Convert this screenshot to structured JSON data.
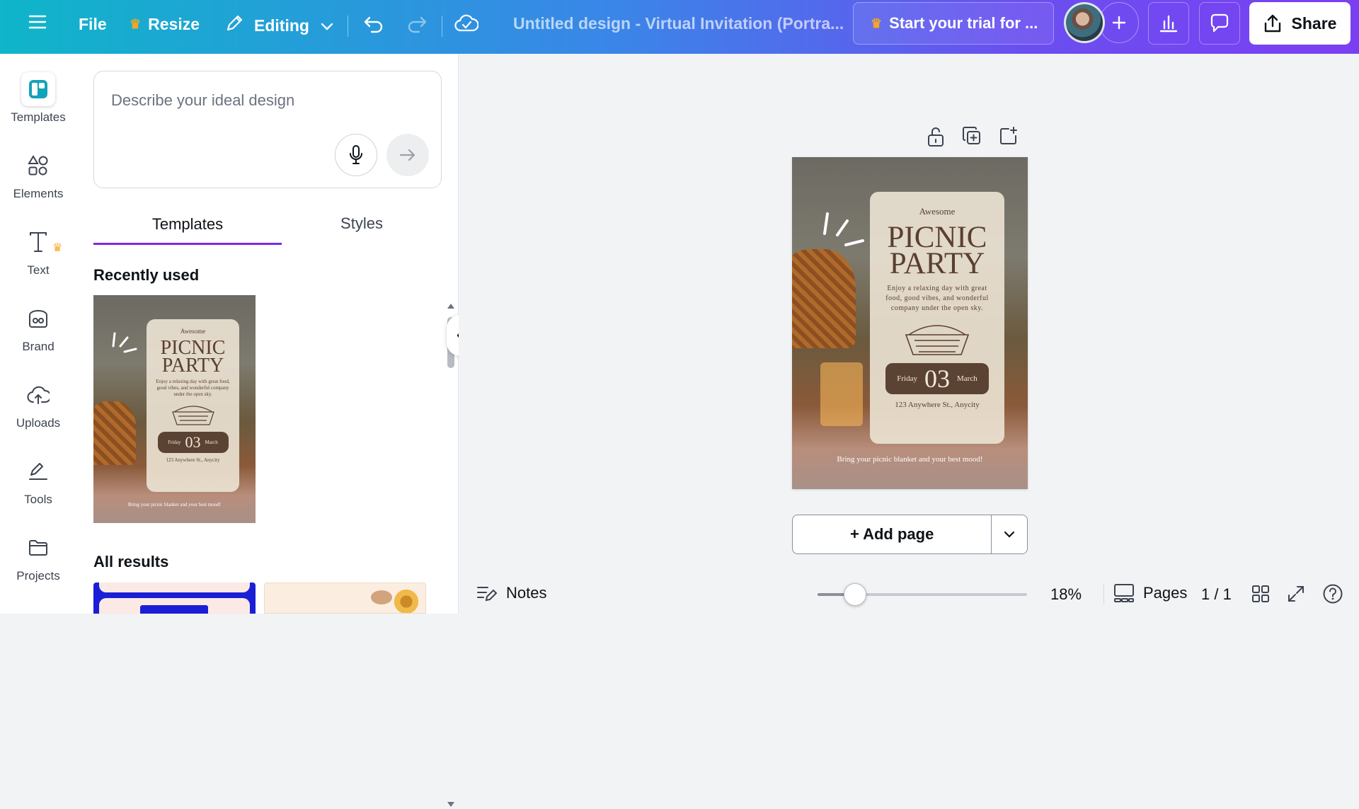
{
  "topbar": {
    "file_label": "File",
    "resize_label": "Resize",
    "editing_label": "Editing",
    "doc_title": "Untitled design - Virtual Invitation (Portra...",
    "trial_label": "Start your trial for ...",
    "share_label": "Share"
  },
  "rail": {
    "items": [
      {
        "label": "Templates"
      },
      {
        "label": "Elements"
      },
      {
        "label": "Text"
      },
      {
        "label": "Brand"
      },
      {
        "label": "Uploads"
      },
      {
        "label": "Tools"
      },
      {
        "label": "Projects"
      }
    ]
  },
  "panel": {
    "prompt_placeholder": "Describe your ideal design",
    "tabs": [
      "Templates",
      "Styles"
    ],
    "recently_used": "Recently used",
    "all_results": "All results"
  },
  "poster": {
    "kicker": "Awesome",
    "title_line1": "PICNIC",
    "title_line2": "PARTY",
    "body": "Enjoy a relaxing day with great food, good vibes, and wonderful company under the open sky.",
    "day": "Friday",
    "date": "03",
    "month": "March",
    "address": "123 Anywhere St., Anycity",
    "footer": "Bring your picnic blanket and your best mood!"
  },
  "canvas": {
    "add_page_label": "+ Add page"
  },
  "bottom": {
    "notes_label": "Notes",
    "zoom_value": "18%",
    "zoom_level": 0.18,
    "pages_label": "Pages",
    "page_count": "1 / 1"
  },
  "colors": {
    "accent": "#7d2ae8",
    "topbar_start": "#0fb5c9",
    "topbar_end": "#7b3ff2",
    "crown": "#f5a623"
  }
}
